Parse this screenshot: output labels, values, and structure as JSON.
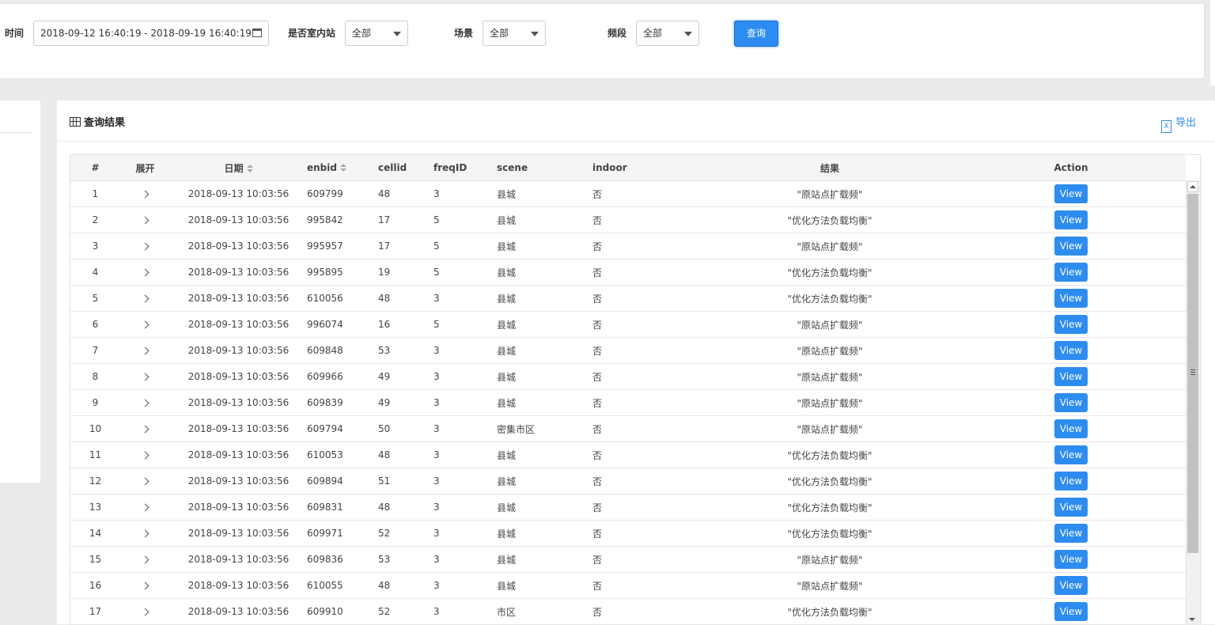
{
  "filters": {
    "time_label": "时间",
    "time_value": "2018-09-12 16:40:19 - 2018-09-19 16:40:19",
    "indoor_label": "是否室内站",
    "indoor_value": "全部",
    "scene_label": "场景",
    "scene_value": "全部",
    "band_label": "频段",
    "band_value": "全部",
    "query_label": "查询"
  },
  "results": {
    "title": "查询结果",
    "export_label": "导出",
    "columns": [
      "#",
      "展开",
      "日期",
      "enbid",
      "cellid",
      "freqID",
      "scene",
      "indoor",
      "结果",
      "Action"
    ],
    "rows": [
      {
        "idx": "1",
        "date": "2018-09-13 10:03:56",
        "enbid": "609799",
        "cellid": "48",
        "freqid": "3",
        "scene": "县城",
        "indoor": "否",
        "result": "\"原站点扩载频\"",
        "action": "View"
      },
      {
        "idx": "2",
        "date": "2018-09-13 10:03:56",
        "enbid": "995842",
        "cellid": "17",
        "freqid": "5",
        "scene": "县城",
        "indoor": "否",
        "result": "\"优化方法负载均衡\"",
        "action": "View"
      },
      {
        "idx": "3",
        "date": "2018-09-13 10:03:56",
        "enbid": "995957",
        "cellid": "17",
        "freqid": "5",
        "scene": "县城",
        "indoor": "否",
        "result": "\"原站点扩载频\"",
        "action": "View"
      },
      {
        "idx": "4",
        "date": "2018-09-13 10:03:56",
        "enbid": "995895",
        "cellid": "19",
        "freqid": "5",
        "scene": "县城",
        "indoor": "否",
        "result": "\"优化方法负载均衡\"",
        "action": "View"
      },
      {
        "idx": "5",
        "date": "2018-09-13 10:03:56",
        "enbid": "610056",
        "cellid": "48",
        "freqid": "3",
        "scene": "县城",
        "indoor": "否",
        "result": "\"优化方法负载均衡\"",
        "action": "View"
      },
      {
        "idx": "6",
        "date": "2018-09-13 10:03:56",
        "enbid": "996074",
        "cellid": "16",
        "freqid": "5",
        "scene": "县城",
        "indoor": "否",
        "result": "\"原站点扩载频\"",
        "action": "View"
      },
      {
        "idx": "7",
        "date": "2018-09-13 10:03:56",
        "enbid": "609848",
        "cellid": "53",
        "freqid": "3",
        "scene": "县城",
        "indoor": "否",
        "result": "\"原站点扩载频\"",
        "action": "View"
      },
      {
        "idx": "8",
        "date": "2018-09-13 10:03:56",
        "enbid": "609966",
        "cellid": "49",
        "freqid": "3",
        "scene": "县城",
        "indoor": "否",
        "result": "\"原站点扩载频\"",
        "action": "View"
      },
      {
        "idx": "9",
        "date": "2018-09-13 10:03:56",
        "enbid": "609839",
        "cellid": "49",
        "freqid": "3",
        "scene": "县城",
        "indoor": "否",
        "result": "\"原站点扩载频\"",
        "action": "View"
      },
      {
        "idx": "10",
        "date": "2018-09-13 10:03:56",
        "enbid": "609794",
        "cellid": "50",
        "freqid": "3",
        "scene": "密集市区",
        "indoor": "否",
        "result": "\"原站点扩载频\"",
        "action": "View"
      },
      {
        "idx": "11",
        "date": "2018-09-13 10:03:56",
        "enbid": "610053",
        "cellid": "48",
        "freqid": "3",
        "scene": "县城",
        "indoor": "否",
        "result": "\"优化方法负载均衡\"",
        "action": "View"
      },
      {
        "idx": "12",
        "date": "2018-09-13 10:03:56",
        "enbid": "609894",
        "cellid": "51",
        "freqid": "3",
        "scene": "县城",
        "indoor": "否",
        "result": "\"优化方法负载均衡\"",
        "action": "View"
      },
      {
        "idx": "13",
        "date": "2018-09-13 10:03:56",
        "enbid": "609831",
        "cellid": "48",
        "freqid": "3",
        "scene": "县城",
        "indoor": "否",
        "result": "\"优化方法负载均衡\"",
        "action": "View"
      },
      {
        "idx": "14",
        "date": "2018-09-13 10:03:56",
        "enbid": "609971",
        "cellid": "52",
        "freqid": "3",
        "scene": "县城",
        "indoor": "否",
        "result": "\"优化方法负载均衡\"",
        "action": "View"
      },
      {
        "idx": "15",
        "date": "2018-09-13 10:03:56",
        "enbid": "609836",
        "cellid": "53",
        "freqid": "3",
        "scene": "县城",
        "indoor": "否",
        "result": "\"原站点扩载频\"",
        "action": "View"
      },
      {
        "idx": "16",
        "date": "2018-09-13 10:03:56",
        "enbid": "610055",
        "cellid": "48",
        "freqid": "3",
        "scene": "县城",
        "indoor": "否",
        "result": "\"原站点扩载频\"",
        "action": "View"
      },
      {
        "idx": "17",
        "date": "2018-09-13 10:03:56",
        "enbid": "609910",
        "cellid": "52",
        "freqid": "3",
        "scene": "市区",
        "indoor": "否",
        "result": "\"优化方法负载均衡\"",
        "action": "View"
      }
    ]
  },
  "colors": {
    "accent": "#2d8cf0",
    "header_bg": "#f5f5f5",
    "page_bg": "#ebebeb"
  }
}
